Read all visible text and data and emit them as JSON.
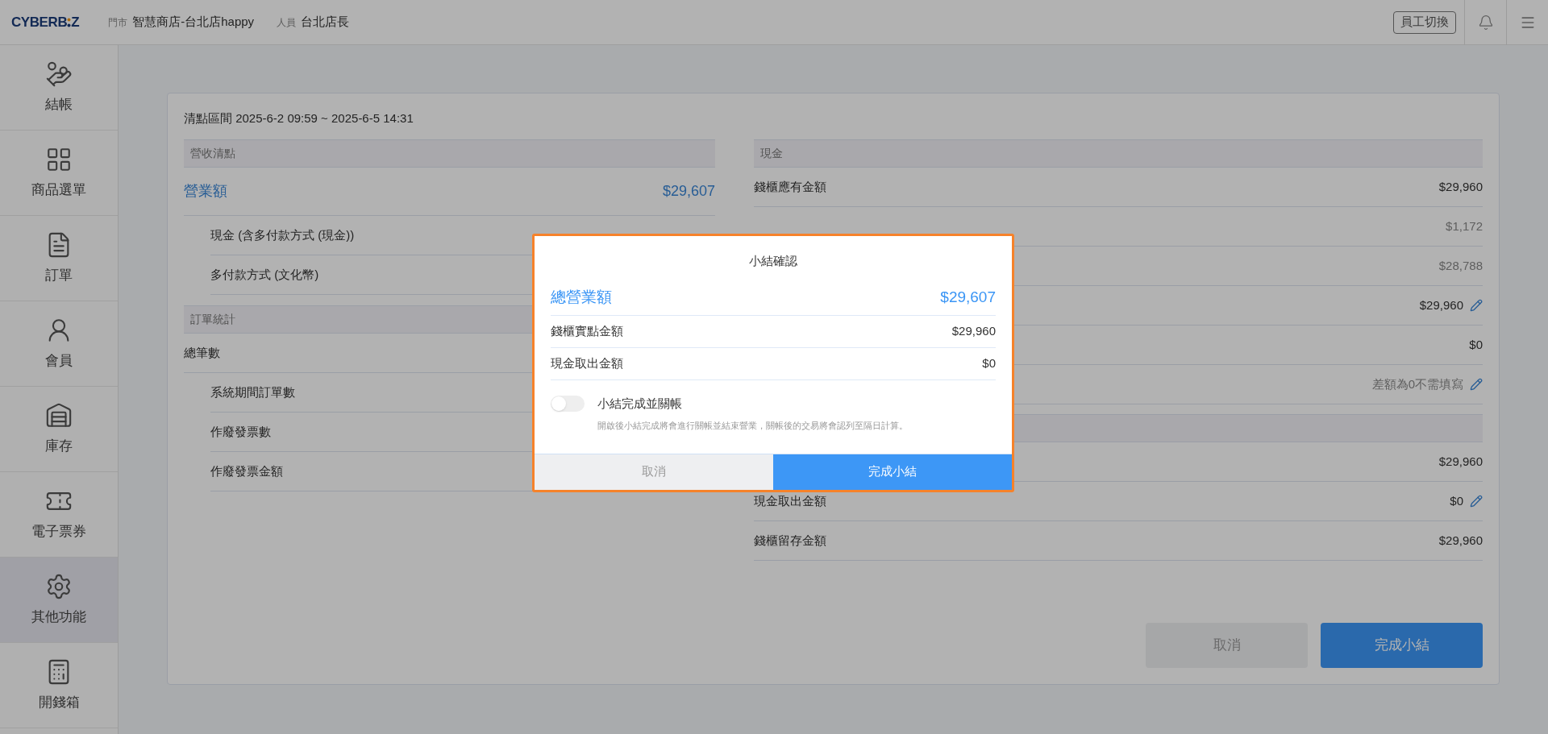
{
  "header": {
    "logo_start": "CYBERB",
    "logo_end": "Z",
    "store_label": "門市",
    "store": "智慧商店-台北店happy",
    "staff_label": "人員",
    "staff": "台北店長",
    "switch_button": "員工切換"
  },
  "sidebar": {
    "items": [
      {
        "label": "結帳",
        "selected": false
      },
      {
        "label": "商品選單",
        "selected": false
      },
      {
        "label": "訂單",
        "selected": false
      },
      {
        "label": "會員",
        "selected": false
      },
      {
        "label": "庫存",
        "selected": false
      },
      {
        "label": "電子票券",
        "selected": false
      },
      {
        "label": "其他功能",
        "selected": true
      },
      {
        "label": "開錢箱",
        "selected": false
      }
    ]
  },
  "card": {
    "period": "清點區間 2025-6-2 09:59 ~ 2025-6-5 14:31",
    "left": [
      {
        "heading": "營收清點",
        "rows": [
          {
            "kind": "total",
            "label": "營業額",
            "value": "$29,607"
          },
          {
            "kind": "sub",
            "label": "現金 (含多付款方式 (現金))"
          },
          {
            "kind": "sub",
            "label": "多付款方式 (文化幣)"
          }
        ]
      },
      {
        "heading": "訂單統計",
        "rows": [
          {
            "kind": "plain",
            "label": "總筆數"
          },
          {
            "kind": "sub",
            "label": "系統期間訂單數"
          },
          {
            "kind": "sub",
            "label": "作廢發票數"
          },
          {
            "kind": "sub",
            "label": "作廢發票金額"
          }
        ]
      }
    ],
    "right": [
      {
        "heading": "現金",
        "rows": [
          {
            "kind": "plain",
            "label": "錢櫃應有金額",
            "value": "$29,960",
            "muted": false,
            "editable": false
          },
          {
            "kind": "sub",
            "value": "$1,172",
            "muted": true,
            "editable": false
          },
          {
            "kind": "sub",
            "value": "$28,788",
            "muted": true,
            "editable": false
          },
          {
            "kind": "plain",
            "value": "$29,960",
            "muted": false,
            "editable": true
          },
          {
            "kind": "plain",
            "value": "$0",
            "muted": false,
            "editable": false
          },
          {
            "kind": "plain",
            "value": "差額為0不需填寫",
            "muted": true,
            "editable": true
          }
        ]
      },
      {
        "rows": [
          {
            "kind": "plain",
            "value": "$29,960",
            "muted": false,
            "editable": false
          },
          {
            "kind": "plain",
            "label": "現金取出金額",
            "value": "$0",
            "muted": false,
            "editable": true
          },
          {
            "kind": "plain",
            "label": "錢櫃留存金額",
            "value": "$29,960",
            "muted": false,
            "editable": false
          }
        ]
      }
    ],
    "buttons": [
      {
        "label": "取消",
        "kind": "secondary"
      },
      {
        "label": "完成小結",
        "kind": "primary"
      }
    ]
  },
  "modal": {
    "title": "小結確認",
    "rows": [
      {
        "kind": "total",
        "label": "總營業額",
        "value": "$29,607"
      },
      {
        "kind": "plain",
        "label": "錢櫃實點金額",
        "value": "$29,960"
      },
      {
        "kind": "plain",
        "label": "現金取出金額",
        "value": "$0"
      }
    ],
    "toggle": {
      "label": "小結完成並關帳",
      "on": false,
      "hint": "開啟後小結完成將會進行關帳並結束營業，關帳後的交易將會認列至隔日計算。"
    },
    "buttons": [
      {
        "label": "取消",
        "kind": "secondary"
      },
      {
        "label": "完成小結",
        "kind": "primary"
      }
    ]
  }
}
